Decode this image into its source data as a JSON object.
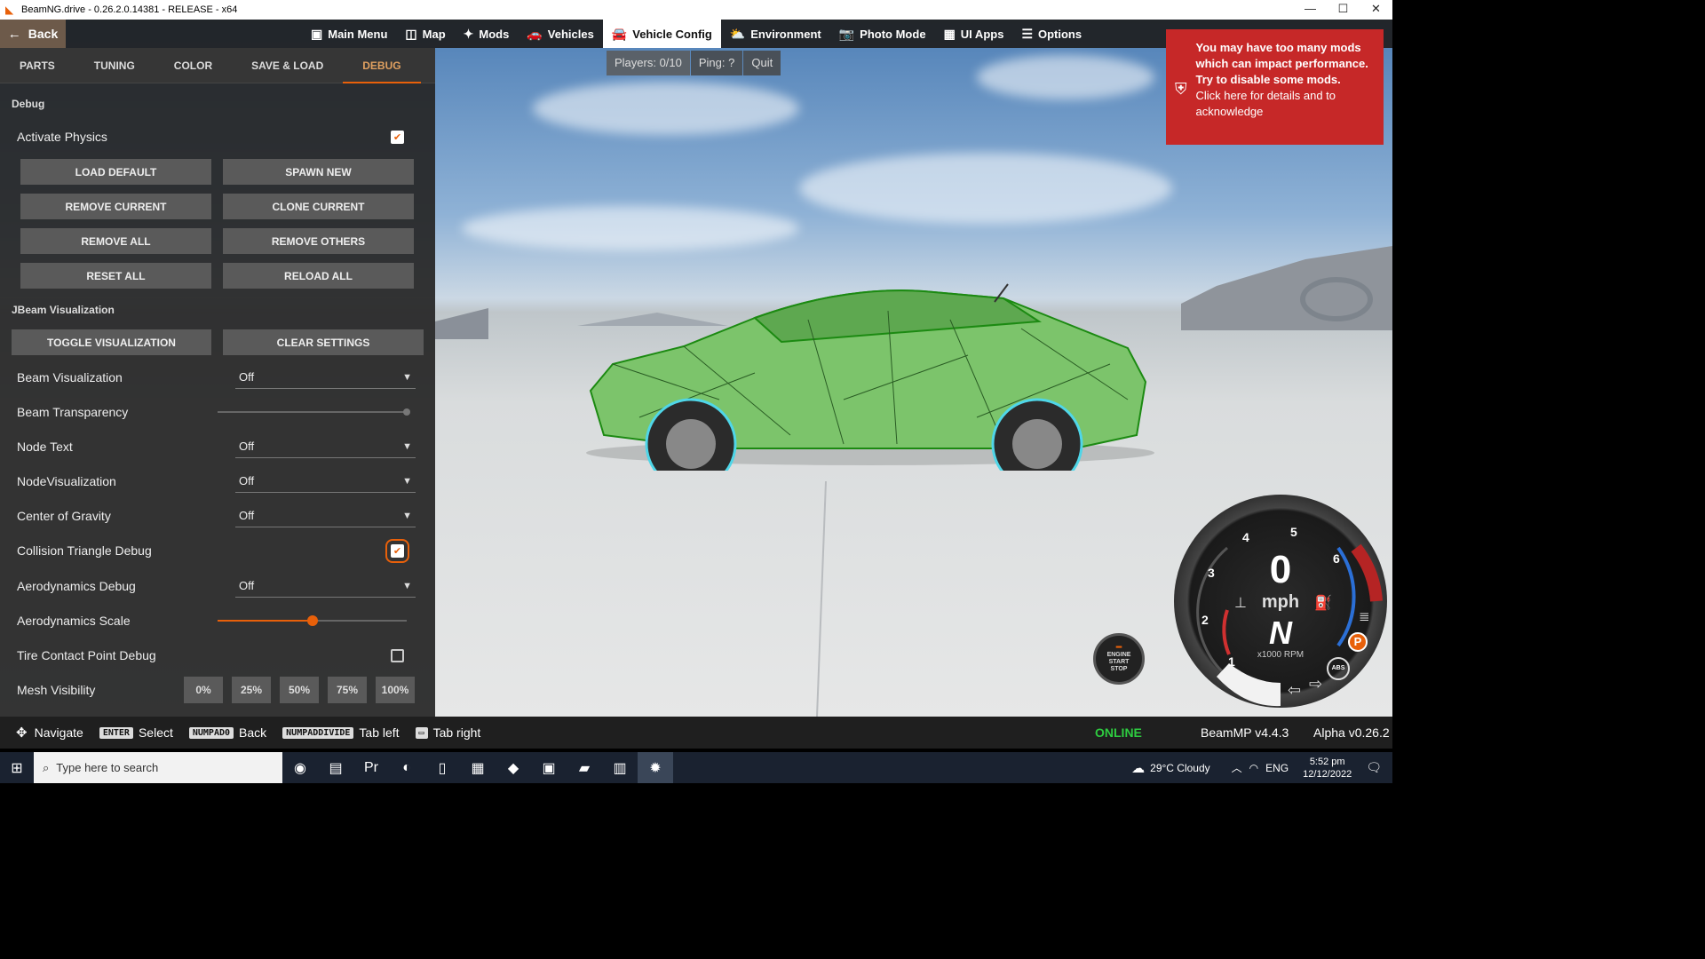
{
  "window": {
    "title": "BeamNG.drive - 0.26.2.0.14381 - RELEASE - x64",
    "minimize": "—",
    "maximize": "☐",
    "close": "✕"
  },
  "nav": {
    "back": "Back",
    "items": [
      "Main Menu",
      "Map",
      "Mods",
      "Vehicles",
      "Vehicle Config",
      "Environment",
      "Photo Mode",
      "UI Apps",
      "Options"
    ],
    "icons": [
      "main-menu-icon",
      "map-icon",
      "puzzle-icon",
      "car-icon",
      "vehicle-config-icon",
      "weather-icon",
      "camera-icon",
      "ui-apps-icon",
      "sliders-icon"
    ],
    "glyphs": [
      "▣",
      "◫",
      "✦",
      "🚗",
      "🚘",
      "⛅",
      "📷",
      "▦",
      "☰"
    ],
    "active": "Vehicle Config"
  },
  "multiplayer": {
    "players": "Players: 0/10",
    "ping": "Ping: ?",
    "quit": "Quit"
  },
  "warning": {
    "line1": "You may have too many mods which can impact performance. Try to disable some mods.",
    "line2": "Click here for details and to acknowledge"
  },
  "tabs": [
    "PARTS",
    "TUNING",
    "COLOR",
    "SAVE & LOAD",
    "DEBUG"
  ],
  "debug": {
    "section": "Debug",
    "activate_physics": "Activate Physics",
    "buttons": [
      "LOAD DEFAULT",
      "SPAWN NEW",
      "REMOVE CURRENT",
      "CLONE CURRENT",
      "REMOVE ALL",
      "REMOVE OTHERS",
      "RESET ALL",
      "RELOAD ALL"
    ]
  },
  "jbeam": {
    "section": "JBeam Visualization",
    "toggle": "TOGGLE VISUALIZATION",
    "clear": "CLEAR SETTINGS",
    "beam_visualization": {
      "label": "Beam Visualization",
      "value": "Off"
    },
    "beam_transparency": {
      "label": "Beam Transparency",
      "value": 1.0
    },
    "node_text": {
      "label": "Node Text",
      "value": "Off"
    },
    "node_visualization": {
      "label": "NodeVisualization",
      "value": "Off"
    },
    "center_of_gravity": {
      "label": "Center of Gravity",
      "value": "Off"
    },
    "collision_triangle": {
      "label": "Collision Triangle Debug",
      "checked": true
    },
    "aero_debug": {
      "label": "Aerodynamics Debug",
      "value": "Off"
    },
    "aero_scale": {
      "label": "Aerodynamics Scale",
      "value": 0.5
    },
    "tire_contact": {
      "label": "Tire Contact Point Debug",
      "checked": false
    },
    "mesh_visibility": {
      "label": "Mesh Visibility",
      "options": [
        "0%",
        "25%",
        "50%",
        "75%",
        "100%"
      ]
    }
  },
  "hints": [
    {
      "key": "",
      "icon": "dpad-icon",
      "label": "Navigate"
    },
    {
      "key": "ENTER",
      "label": "Select"
    },
    {
      "key": "NUMPAD0",
      "label": "Back"
    },
    {
      "key": "NUMPADDIVIDE",
      "label": "Tab left"
    },
    {
      "key": "",
      "icon": "keyboard-icon",
      "label": "Tab right"
    }
  ],
  "status": {
    "online": "ONLINE",
    "beammp": "BeamMP v4.4.3",
    "alpha": "Alpha v0.26.2"
  },
  "dash": {
    "speed": "0",
    "unit": "mph",
    "gear": "N",
    "rpm_label": "x1000 RPM",
    "ticks": [
      "1",
      "2",
      "3",
      "4",
      "5",
      "6"
    ],
    "park": "P",
    "abs": "ABS",
    "engine": [
      "ENGINE",
      "START",
      "STOP"
    ]
  },
  "taskbar": {
    "search": "Type here to search",
    "weather": "29°C  Cloudy",
    "lang": "ENG",
    "time": "5:52 pm",
    "date": "12/12/2022",
    "apps": [
      "chrome-icon",
      "teams-icon",
      "premiere-icon",
      "edge-icon",
      "file-icon",
      "archive-icon",
      "game-icon",
      "media-icon",
      "folder-icon",
      "winrar-icon",
      "beammp-icon"
    ],
    "glyphs": [
      "◉",
      "▤",
      "Pr",
      "◐",
      "▯",
      "▦",
      "◆",
      "▣",
      "▰",
      "▥",
      "✹"
    ]
  },
  "colors": {
    "accent": "#e8600a",
    "warning": "#c62828",
    "online": "#2ecc40"
  }
}
